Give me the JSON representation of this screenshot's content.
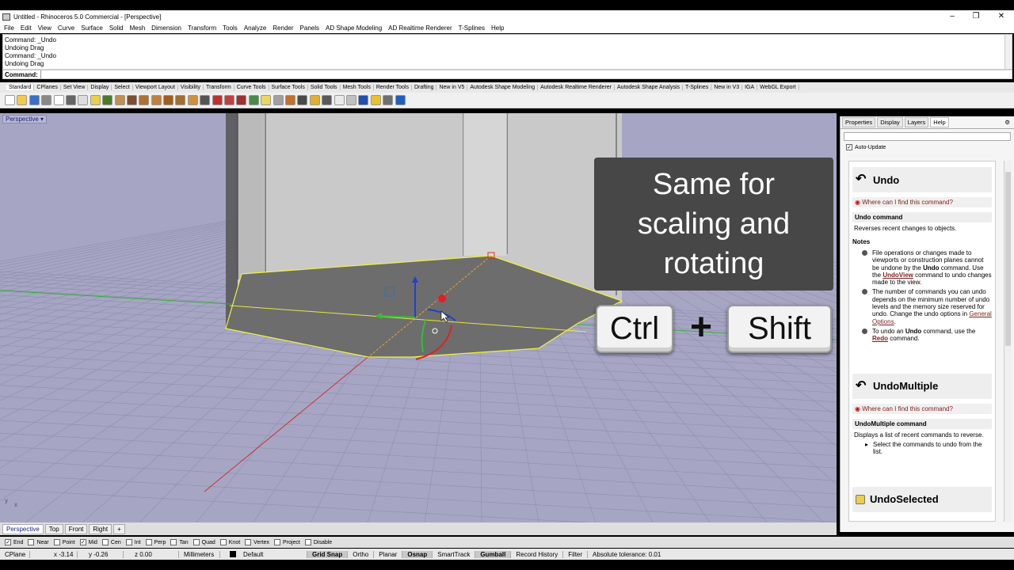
{
  "window": {
    "title": "Untitled - Rhinoceros 5.0 Commercial - [Perspective]"
  },
  "menu": [
    "File",
    "Edit",
    "View",
    "Curve",
    "Surface",
    "Solid",
    "Mesh",
    "Dimension",
    "Transform",
    "Tools",
    "Analyze",
    "Render",
    "Panels",
    "AD Shape Modeling",
    "AD Realtime Renderer",
    "T-Splines",
    "Help"
  ],
  "history": [
    "Command: _Undo",
    "Undoing Drag",
    "Command: _Undo",
    "Undoing Drag"
  ],
  "command": {
    "label": "Command:"
  },
  "toolbar_tabs": [
    "Standard",
    "CPlanes",
    "Set View",
    "Display",
    "Select",
    "Viewport Layout",
    "Visibility",
    "Transform",
    "Curve Tools",
    "Surface Tools",
    "Solid Tools",
    "Mesh Tools",
    "Render Tools",
    "Drafting",
    "New in V5",
    "Autodesk Shape Modeling",
    "Autodesk Realtime Renderer",
    "Autodesk Shape Analysis",
    "T-Splines",
    "New in V3",
    "IGA",
    "WebGL Export"
  ],
  "toolbar_icons": [
    "new-icon",
    "open-icon",
    "save-icon",
    "print-icon",
    "import-icon",
    "cut-icon",
    "copy-icon",
    "paste-icon",
    "undo-icon",
    "pan-icon",
    "move-icon",
    "zoom-icon",
    "zoom-window-icon",
    "zoom-extents-icon",
    "zoom-selected-icon",
    "rotate-view-icon",
    "four-views-icon",
    "cplane-icon",
    "cplane-origin-icon",
    "perspective-icon",
    "named-views-icon",
    "light-icon",
    "lock-icon",
    "select-icon",
    "properties-icon",
    "color-icon",
    "render-icon",
    "shade-icon",
    "render-preview-icon",
    "material-icon",
    "settings-icon",
    "tools-icon",
    "help-icon"
  ],
  "viewport": {
    "label": "Perspective"
  },
  "overlay": {
    "line1": "Same for",
    "line2": "scaling and",
    "line3": "rotating",
    "key1": "Ctrl",
    "plus": "+",
    "key2": "Shift"
  },
  "viewport_tabs": [
    "Perspective",
    "Top",
    "Front",
    "Right"
  ],
  "osnaps": [
    {
      "label": "End",
      "checked": true
    },
    {
      "label": "Near",
      "checked": false
    },
    {
      "label": "Point",
      "checked": false
    },
    {
      "label": "Mid",
      "checked": true
    },
    {
      "label": "Cen",
      "checked": false
    },
    {
      "label": "Int",
      "checked": false
    },
    {
      "label": "Perp",
      "checked": false
    },
    {
      "label": "Tan",
      "checked": false
    },
    {
      "label": "Quad",
      "checked": false
    },
    {
      "label": "Knot",
      "checked": false
    },
    {
      "label": "Vertex",
      "checked": false
    },
    {
      "label": "Project",
      "checked": false
    },
    {
      "label": "Disable",
      "checked": false
    }
  ],
  "status": {
    "cplane": "CPlane",
    "x": "x -3.14",
    "y": "y -0.26",
    "z": "z 0.00",
    "units": "Millimeters",
    "layer": "Default",
    "grid_snap": "Grid Snap",
    "ortho": "Ortho",
    "planar": "Planar",
    "osnap": "Osnap",
    "smarttrack": "SmartTrack",
    "gumball": "Gumball",
    "record_history": "Record History",
    "filter": "Filter",
    "tolerance": "Absolute tolerance: 0.01"
  },
  "panel": {
    "tabs": [
      "Properties",
      "Display",
      "Layers",
      "Help"
    ],
    "auto_update": "Auto-Update",
    "undo_title": "Undo",
    "where": "Where can I find this command?",
    "undo_cmd": "Undo command",
    "undo_desc": "Reverses recent changes to objects.",
    "notes": "Notes",
    "note1": {
      "a": "File operations or changes made to viewports or construction planes cannot be undone by the ",
      "b": "Undo",
      "c": " command. Use the ",
      "d": "UndoView",
      "e": " command to undo changes made to the view."
    },
    "note2": {
      "a": "The number of commands you can undo depends on the minimum number of undo levels and the memory size reserved for undo. Change the undo options in ",
      "b": "General Options",
      "c": "."
    },
    "note3": {
      "a": "To undo an ",
      "b": "Undo",
      "c": " command, use the ",
      "d": "Redo",
      "e": " command."
    },
    "um_title": "UndoMultiple",
    "um_cmd": "UndoMultiple command",
    "um_desc": "Displays a list of recent commands to reverse.",
    "um_step": "Select the commands to undo from the list.",
    "us_title": "UndoSelected"
  }
}
